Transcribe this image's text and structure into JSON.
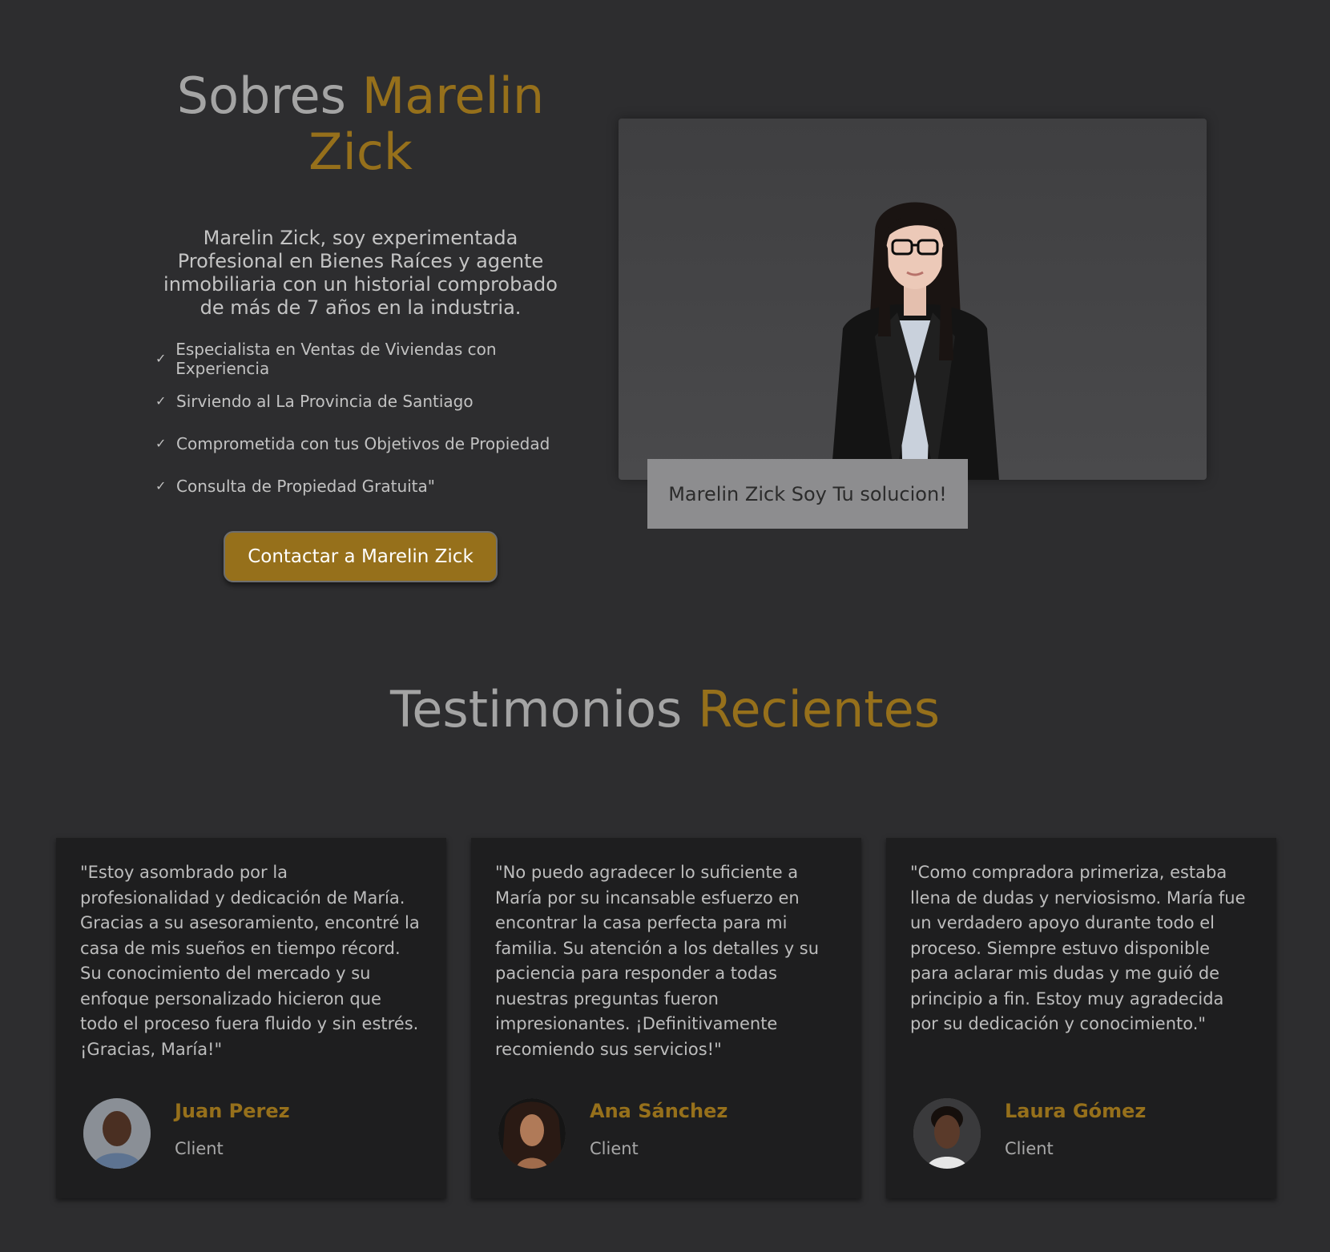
{
  "about": {
    "title_part1": "Sobres",
    "title_part2": "Marelin Zick",
    "intro": "Marelin Zick, soy experimentada Profesional en Bienes Raíces y agente inmobiliaria con un historial comprobado de más de 7 años en la industria.",
    "checklist": [
      "Especialista en Ventas de Viviendas con Experiencia",
      "Sirviendo al La Provincia de Santiago",
      "Comprometida con tus Objetivos de Propiedad",
      "Consulta de Propiedad Gratuita\""
    ],
    "check_icon": "check-icon",
    "cta_label": "Contactar a Marelin Zick",
    "photo_caption": "Marelin Zick Soy Tu solucion!"
  },
  "testimonials": {
    "title_part1": "Testimonios",
    "title_part2": "Recientes",
    "items": [
      {
        "quote": "\"Estoy asombrado por la profesionalidad y dedicación de María. Gracias a su asesoramiento, encontré la casa de mis sueños en tiempo récord. Su conocimiento del mercado y su enfoque personalizado hicieron que todo el proceso fuera fluido y sin estrés. ¡Gracias, María!\"",
        "name": "Juan Perez",
        "role": "Client"
      },
      {
        "quote": "\"No puedo agradecer lo suficiente a María por su incansable esfuerzo en encontrar la casa perfecta para mi familia. Su atención a los detalles y su paciencia para responder a todas nuestras preguntas fueron impresionantes. ¡Definitivamente recomiendo sus servicios!\"",
        "name": "Ana Sánchez",
        "role": "Client"
      },
      {
        "quote": "\"Como compradora primeriza, estaba llena de dudas y nerviosismo. María fue un verdadero apoyo durante todo el proceso. Siempre estuvo disponible para aclarar mis dudas y me guió de principio a fin. Estoy muy agradecida por su dedicación y conocimiento.\"",
        "name": "Laura Gómez",
        "role": "Client"
      }
    ]
  },
  "colors": {
    "background": "#2d2d2f",
    "accent_gold": "#96701b",
    "card_background": "#1e1e1f",
    "caption_background": "#8d8d8f"
  }
}
